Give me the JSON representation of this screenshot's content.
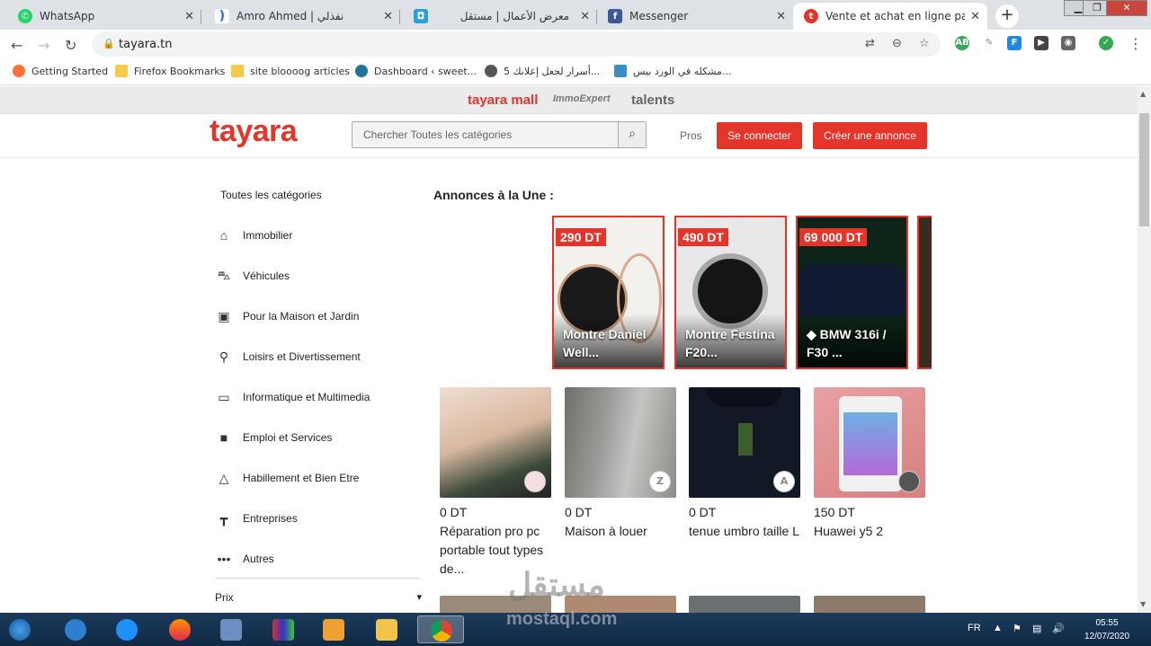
{
  "browser": {
    "tabs": [
      {
        "title": "WhatsApp",
        "icon": "whatsapp-icon",
        "color": "#25d366"
      },
      {
        "title": "Amro Ahmed | نفذلي",
        "icon": "nafzly-icon",
        "color": "#1a73e8"
      },
      {
        "title": "معرض الأعمال | مستقل",
        "icon": "mostaql-icon",
        "color": "#2a9fd8"
      },
      {
        "title": "Messenger",
        "icon": "facebook-icon",
        "color": "#3b5998"
      },
      {
        "title": "Vente et achat en ligne partout",
        "icon": "tayara-icon",
        "color": "#e5352b"
      }
    ],
    "url": "tayara.tn",
    "bookmarks": [
      {
        "label": "Getting Started",
        "icon": "firefox-icon"
      },
      {
        "label": "Firefox Bookmarks",
        "icon": "folder-icon"
      },
      {
        "label": "site bloooog articles",
        "icon": "folder-icon"
      },
      {
        "label": "Dashboard ‹ sweet...",
        "icon": "wordpress-icon"
      },
      {
        "label": "5 أسرار لجعل إعلانك...",
        "icon": "globe-icon"
      },
      {
        "label": "مشكله في الورد بيس...",
        "icon": "page-icon"
      }
    ]
  },
  "site": {
    "brands": [
      "tayara mall",
      "ImmoExpert",
      "talents"
    ],
    "logo": "tayara",
    "search_placeholder": "Chercher Toutes les catégories",
    "pros": "Pros",
    "login": "Se connecter",
    "create_ad": "Créer une annonce",
    "brand_color": "#e5352b"
  },
  "sidebar": {
    "title": "Toutes les catégories",
    "categories": [
      {
        "label": "Immobilier",
        "icon": "home-icon"
      },
      {
        "label": "Véhicules",
        "icon": "car-icon"
      },
      {
        "label": "Pour la Maison et Jardin",
        "icon": "appliance-icon"
      },
      {
        "label": "Loisirs et Divertissement",
        "icon": "bike-icon"
      },
      {
        "label": "Informatique et Multimedia",
        "icon": "computer-icon"
      },
      {
        "label": "Emploi et Services",
        "icon": "briefcase-icon"
      },
      {
        "label": "Habillement et Bien Etre",
        "icon": "hanger-icon"
      },
      {
        "label": "Entreprises",
        "icon": "paint-roller-icon"
      },
      {
        "label": "Autres",
        "icon": "more-icon"
      }
    ],
    "price_filter": "Prix"
  },
  "featured": {
    "title": "Annonces à la Une :",
    "items": [
      {
        "price": "290 DT",
        "title": "Montre Daniel Well..."
      },
      {
        "price": "490 DT",
        "title": "Montre Festina F20..."
      },
      {
        "price": "69 000 DT",
        "title": "◆ BMW 316i / F30 ..."
      }
    ]
  },
  "listings": [
    {
      "price": "0 DT",
      "title": "Réparation pro pc portable tout types de...",
      "avatar": ""
    },
    {
      "price": "0 DT",
      "title": "Maison à louer",
      "avatar": "Z"
    },
    {
      "price": "0 DT",
      "title": "tenue umbro taille L",
      "avatar": "A"
    },
    {
      "price": "150 DT",
      "title": "Huawei y5 2",
      "avatar": ""
    }
  ],
  "watermark": {
    "arabic": "مستقل",
    "latin": "mostaql.com"
  },
  "taskbar": {
    "lang": "FR",
    "time": "05:55",
    "date": "12/07/2020"
  }
}
